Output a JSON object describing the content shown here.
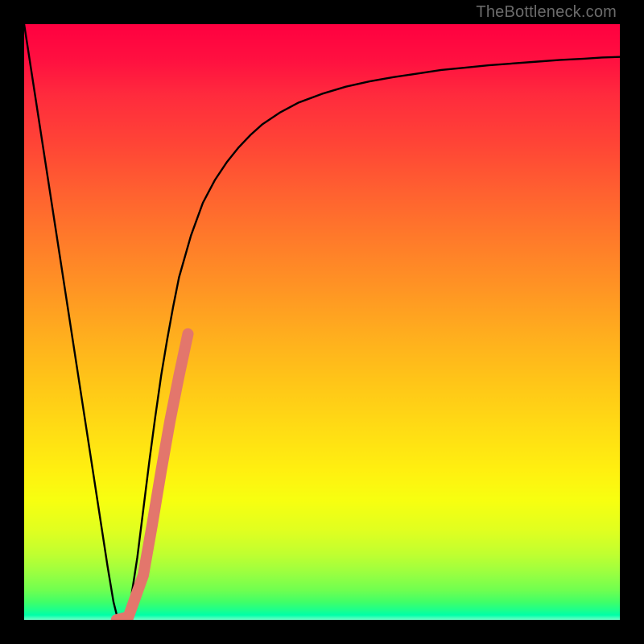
{
  "watermark": "TheBottleneck.com",
  "chart_data": {
    "type": "line",
    "title": "",
    "xlabel": "",
    "ylabel": "",
    "xlim": [
      0,
      1
    ],
    "ylim": [
      0,
      1
    ],
    "series": [
      {
        "name": "bottleneck-curve",
        "x": [
          0.0,
          0.02,
          0.04,
          0.06,
          0.08,
          0.1,
          0.12,
          0.13,
          0.14,
          0.15,
          0.155,
          0.16,
          0.17,
          0.18,
          0.19,
          0.2,
          0.21,
          0.22,
          0.23,
          0.24,
          0.25,
          0.26,
          0.28,
          0.3,
          0.32,
          0.34,
          0.36,
          0.38,
          0.4,
          0.43,
          0.46,
          0.5,
          0.54,
          0.58,
          0.62,
          0.66,
          0.7,
          0.74,
          0.78,
          0.82,
          0.86,
          0.9,
          0.94,
          0.97,
          1.0
        ],
        "y": [
          1.0,
          0.87,
          0.74,
          0.61,
          0.48,
          0.35,
          0.22,
          0.155,
          0.09,
          0.03,
          0.01,
          0.0,
          0.01,
          0.04,
          0.105,
          0.185,
          0.265,
          0.34,
          0.41,
          0.47,
          0.525,
          0.575,
          0.645,
          0.7,
          0.738,
          0.768,
          0.793,
          0.814,
          0.832,
          0.852,
          0.868,
          0.883,
          0.895,
          0.904,
          0.911,
          0.917,
          0.923,
          0.927,
          0.931,
          0.934,
          0.937,
          0.94,
          0.942,
          0.944,
          0.945
        ]
      },
      {
        "name": "highlight-segment",
        "x": [
          0.155,
          0.175,
          0.2,
          0.215,
          0.23,
          0.245,
          0.26,
          0.275
        ],
        "y": [
          0.0,
          0.005,
          0.075,
          0.16,
          0.25,
          0.335,
          0.41,
          0.48
        ]
      }
    ],
    "annotations": []
  }
}
